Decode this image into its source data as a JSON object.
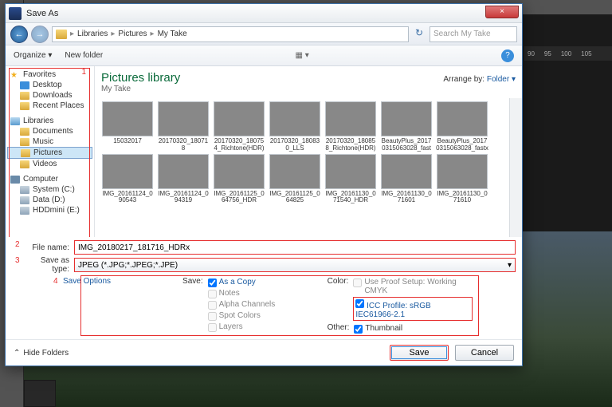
{
  "dialog": {
    "title": "Save As",
    "close": "×"
  },
  "nav": {
    "back": "←",
    "fwd": "→",
    "crumbs": [
      "Libraries",
      "Pictures",
      "My Take"
    ],
    "search_placeholder": "Search My Take",
    "refresh": "↻"
  },
  "toolbar": {
    "organize": "Organize ▾",
    "newfolder": "New folder",
    "help": "?"
  },
  "sidebar": {
    "fav": {
      "head": "Favorites",
      "items": [
        "Desktop",
        "Downloads",
        "Recent Places"
      ]
    },
    "lib": {
      "head": "Libraries",
      "items": [
        "Documents",
        "Music",
        "Pictures",
        "Videos"
      ]
    },
    "comp": {
      "head": "Computer",
      "items": [
        "System (C:)",
        "Data (D:)",
        "HDDmini (E:)"
      ]
    }
  },
  "main": {
    "title": "Pictures library",
    "subtitle": "My Take",
    "arrange_label": "Arrange by:",
    "arrange_value": "Folder ▾",
    "thumbs": [
      {
        "label": "15032017",
        "tint": "t-sky"
      },
      {
        "label": "20170320_180718",
        "tint": "t-sun"
      },
      {
        "label": "20170320_180754_Richtone(HDR)",
        "tint": "t-sun"
      },
      {
        "label": "20170320_180830_LLS",
        "tint": "t-cloud"
      },
      {
        "label": "20170320_180858_Richtone(HDR)",
        "tint": "t-cloud"
      },
      {
        "label": "BeautyPlus_20170315063028_fast",
        "tint": "t-sky"
      },
      {
        "label": "BeautyPlus_20170315063028_fastx",
        "tint": "t-sky"
      },
      {
        "label": "IMG_20161124_090543",
        "tint": "t-grn"
      },
      {
        "label": "IMG_20161124_094319",
        "tint": "t-grn"
      },
      {
        "label": "IMG_20161125_064756_HDR",
        "tint": "t-cloud"
      },
      {
        "label": "IMG_20161125_064825",
        "tint": "t-cloud"
      },
      {
        "label": "IMG_20161130_071540_HDR",
        "tint": "t-dark"
      },
      {
        "label": "IMG_20161130_071601",
        "tint": "t-dark"
      },
      {
        "label": "IMG_20161130_071610",
        "tint": "t-dark"
      }
    ]
  },
  "fields": {
    "filename_label": "File name:",
    "filename_value": "IMG_20180217_181716_HDRx",
    "type_label": "Save as type:",
    "type_value": "JPEG (*.JPG;*.JPEG;*.JPE)"
  },
  "options": {
    "link": "Save Options",
    "save_label": "Save:",
    "as_copy": "As a Copy",
    "notes": "Notes",
    "alpha": "Alpha Channels",
    "spot": "Spot Colors",
    "layers": "Layers",
    "color_label": "Color:",
    "proof": "Use Proof Setup: Working CMYK",
    "icc": "ICC Profile: sRGB IEC61966-2.1",
    "other_label": "Other:",
    "thumbnail": "Thumbnail"
  },
  "buttons": {
    "hide": "Hide Folders",
    "save": "Save",
    "cancel": "Cancel"
  },
  "ruler": {
    "t1": "90",
    "t2": "95",
    "t3": "100",
    "t4": "105"
  },
  "annot": {
    "n1": "1",
    "n2": "2",
    "n3": "3",
    "n4": "4"
  }
}
